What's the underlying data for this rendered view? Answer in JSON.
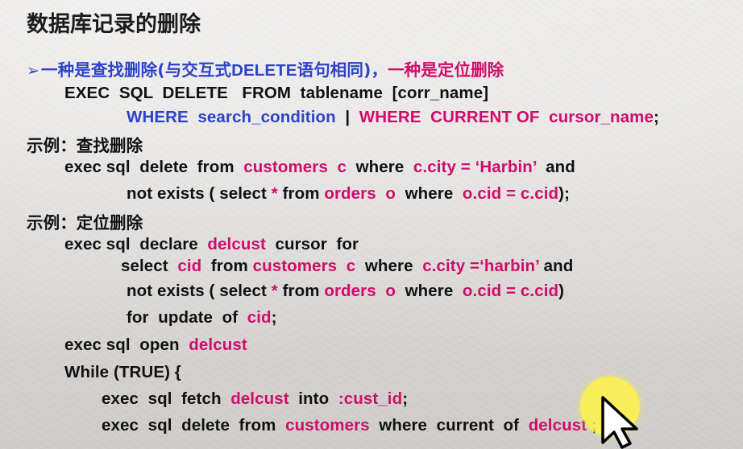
{
  "title": "数据库记录的删除",
  "bullet": {
    "arrow": "➢",
    "text_a": "一种是查找删除(与交互式",
    "text_delete": "DELETE",
    "text_b": "语句相同)，",
    "text_c": "一种是定位删除"
  },
  "syntax": {
    "line1": "EXEC  SQL  DELETE   FROM  tablename  [corr_name]",
    "l2_where": "WHERE  search_condition",
    "l2_bar": "  |  ",
    "l2_current": "WHERE  CURRENT OF  cursor_name",
    "l2_end": ";"
  },
  "example1": {
    "heading": "示例：查找删除",
    "l1_a": "exec sql  delete  from  ",
    "l1_tbl": "customers  c",
    "l1_b": "  where  ",
    "l1_cond": "c.city = ‘Harbin’",
    "l1_c": "  and",
    "l2_a": "not exists ( select ",
    "l2_star": "*",
    "l2_b": " from ",
    "l2_orders": "orders  o",
    "l2_c": "  where  ",
    "l2_cond": "o.cid = c.cid",
    "l2_d": ");"
  },
  "example2": {
    "heading": "示例：定位删除",
    "l1_a": "exec sql  declare  ",
    "l1_name": "delcust",
    "l1_b": "  cursor  for",
    "l2_a": "select  ",
    "l2_cid": "cid",
    "l2_b": "  from ",
    "l2_tbl": "customers  c",
    "l2_c": "  where  ",
    "l2_cond": "c.city =‘harbin’",
    "l2_d": " and",
    "l3_a": "not exists ( select ",
    "l3_star": "*",
    "l3_b": " from ",
    "l3_orders": "orders  o",
    "l3_c": "  where  ",
    "l3_cond": "o.cid = c.cid",
    "l3_d": ")",
    "l4_a": "for  update  of  ",
    "l4_cid": "cid",
    "l4_b": ";",
    "l5_a": "exec sql  open  ",
    "l5_name": "delcust",
    "l6": "While (TRUE) {",
    "l7_a": "exec  sql  fetch  ",
    "l7_name": "delcust",
    "l7_b": "  into  ",
    "l7_var": ":cust_id",
    "l7_c": ";",
    "l8_a": "exec  sql  delete  from  ",
    "l8_tbl": "customers",
    "l8_b": "  where  current  of  ",
    "l8_name": "delcust",
    "l8_c": " ;  }"
  },
  "colors": {
    "keyword_blue": "#2e43c8",
    "highlight_magenta": "#d10c6b",
    "text_black": "#111111",
    "laser_pointer_yellow": "#fff346"
  },
  "icons": [
    "bullet-arrow-icon",
    "mouse-pointer-icon"
  ]
}
